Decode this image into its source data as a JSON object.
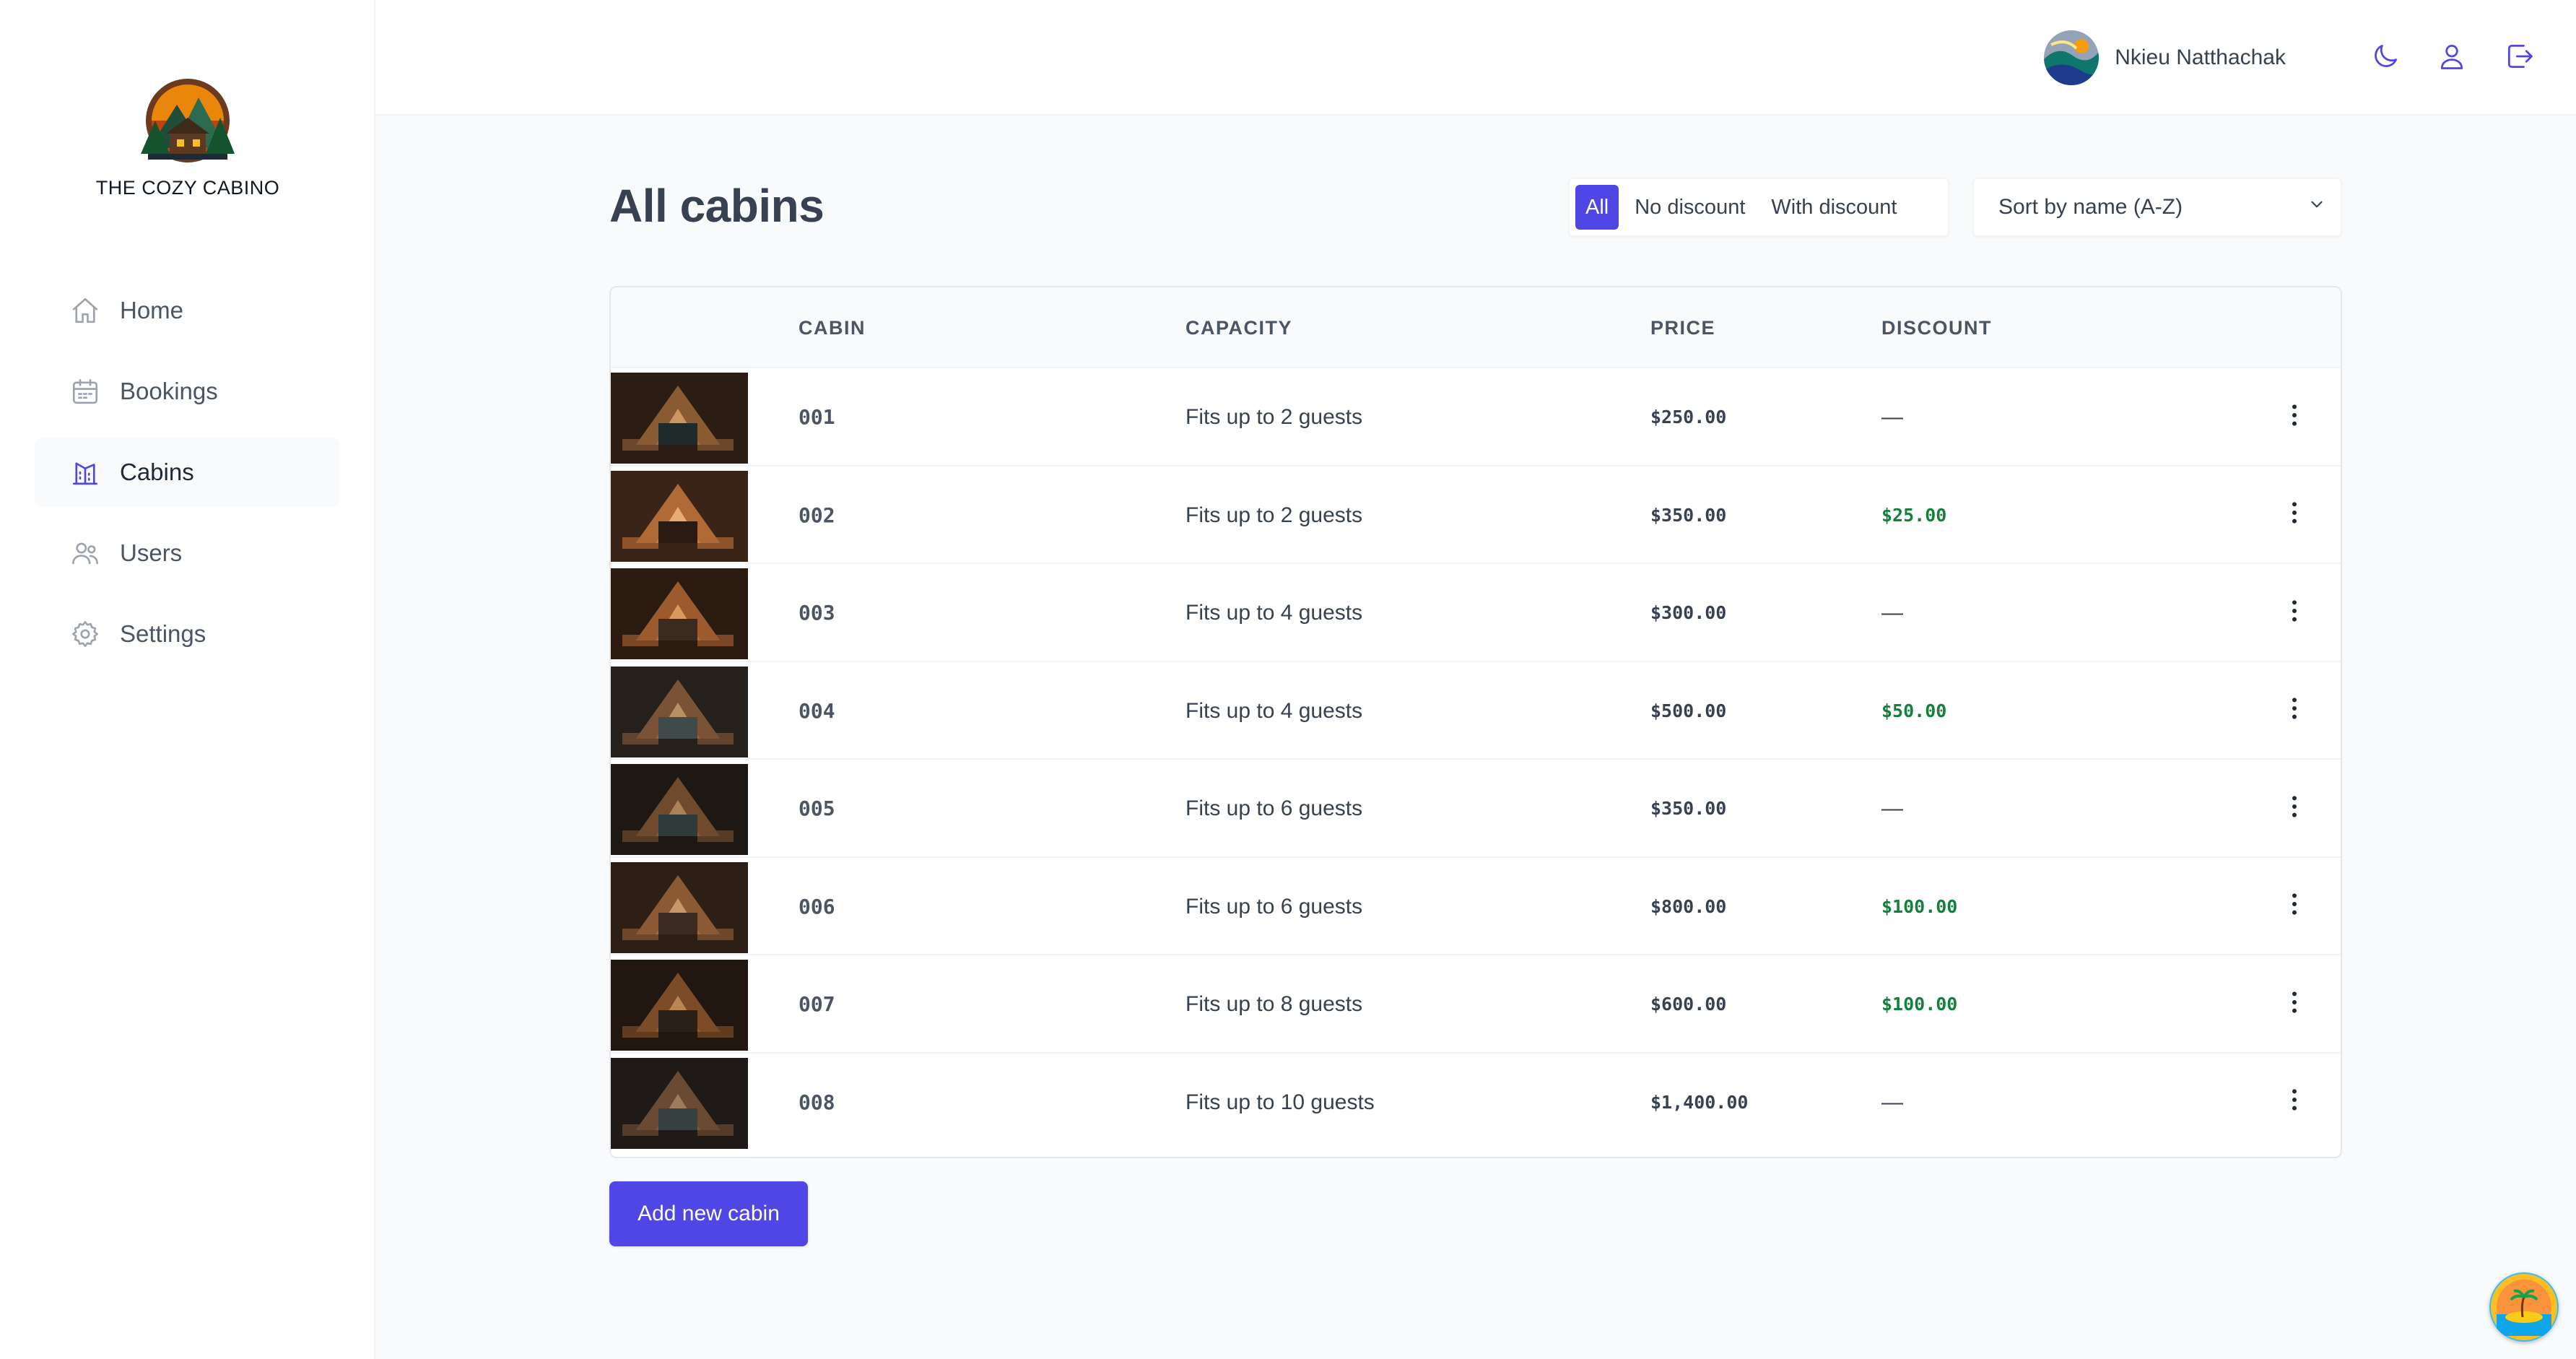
{
  "app": {
    "logo_text": "THE COZY CABINO"
  },
  "sidebar": {
    "items": [
      {
        "label": "Home",
        "icon": "home-icon"
      },
      {
        "label": "Bookings",
        "icon": "calendar-icon"
      },
      {
        "label": "Cabins",
        "icon": "cabin-icon",
        "active": true
      },
      {
        "label": "Users",
        "icon": "users-icon"
      },
      {
        "label": "Settings",
        "icon": "gear-icon"
      }
    ]
  },
  "header": {
    "user_name": "Nkieu Natthachak",
    "actions": [
      "moon-icon",
      "user-icon",
      "logout-icon"
    ]
  },
  "main": {
    "title": "All cabins",
    "filter": {
      "options": [
        "All",
        "No discount",
        "With discount"
      ],
      "active": "All"
    },
    "sort": {
      "selected": "Sort by name (A-Z)"
    },
    "table": {
      "columns": [
        "CABIN",
        "CAPACITY",
        "PRICE",
        "DISCOUNT"
      ],
      "rows": [
        {
          "name": "001",
          "capacity": "Fits up to 2 guests",
          "price": "$250.00",
          "discount": "—"
        },
        {
          "name": "002",
          "capacity": "Fits up to 2 guests",
          "price": "$350.00",
          "discount": "$25.00"
        },
        {
          "name": "003",
          "capacity": "Fits up to 4 guests",
          "price": "$300.00",
          "discount": "—"
        },
        {
          "name": "004",
          "capacity": "Fits up to 4 guests",
          "price": "$500.00",
          "discount": "$50.00"
        },
        {
          "name": "005",
          "capacity": "Fits up to 6 guests",
          "price": "$350.00",
          "discount": "—"
        },
        {
          "name": "006",
          "capacity": "Fits up to 6 guests",
          "price": "$800.00",
          "discount": "$100.00"
        },
        {
          "name": "007",
          "capacity": "Fits up to 8 guests",
          "price": "$600.00",
          "discount": "$100.00"
        },
        {
          "name": "008",
          "capacity": "Fits up to 10 guests",
          "price": "$1,400.00",
          "discount": "—"
        }
      ]
    },
    "add_button": "Add new cabin"
  },
  "colors": {
    "accent": "#4f46e5",
    "discount": "#15803d",
    "text": "#374151"
  }
}
